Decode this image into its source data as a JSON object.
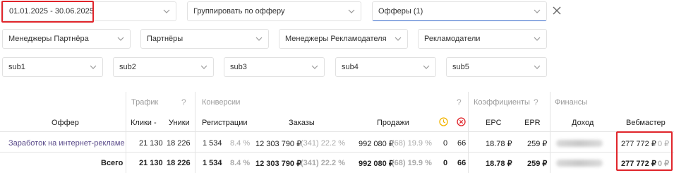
{
  "filters": {
    "date_range": "01.01.2025 - 30.06.2025",
    "group_by": "Группировать по офферу",
    "offers": "Офферы (1)",
    "partner_managers": "Менеджеры Партнёра",
    "partners": "Партнёры",
    "advertiser_managers": "Менеджеры Рекламодателя",
    "advertisers": "Рекламодатели",
    "sub1": "sub1",
    "sub2": "sub2",
    "sub3": "sub3",
    "sub4": "sub4",
    "sub5": "sub5"
  },
  "table": {
    "groups": {
      "traffic": "Трафик",
      "conversions": "Конверсии",
      "coefficients": "Коэффициенты",
      "finance": "Финансы",
      "help": "?"
    },
    "columns": {
      "offer": "Оффер",
      "clicks": "Клики",
      "clicks_sort": "-",
      "uniques": "Уники",
      "registrations": "Регистрации",
      "orders": "Заказы",
      "sales": "Продажи",
      "epc": "EPC",
      "epr": "EPR",
      "income": "Доход",
      "webmaster": "Вебмастер"
    },
    "rows": [
      {
        "offer": "Заработок на интернет-рекламе",
        "clicks": "21 130",
        "uniques": "18 226",
        "registrations": "1 534",
        "reg_pct": "8.4 %",
        "orders": "12 303 790 ₽",
        "orders_extra": "(341) 22.2 %",
        "sales": "992 080 ₽",
        "sales_extra": "(68) 19.9 %",
        "pending": "0",
        "rejected": "66",
        "epc": "18.78 ₽",
        "epr": "259 ₽",
        "webmaster": "277 772 ₽",
        "webmaster_extra": "0 ₽"
      },
      {
        "offer": "Всего",
        "clicks": "21 130",
        "uniques": "18 226",
        "registrations": "1 534",
        "reg_pct": "8.4 %",
        "orders": "12 303 790 ₽",
        "orders_extra": "(341) 22.2 %",
        "sales": "992 080 ₽",
        "sales_extra": "(68) 19.9 %",
        "pending": "0",
        "rejected": "66",
        "epc": "18.78 ₽",
        "epr": "259 ₽",
        "webmaster": "277 772 ₽",
        "webmaster_extra": "0 ₽"
      }
    ]
  },
  "colors": {
    "highlight_red": "#e0252b",
    "pending_icon": "#f2b400",
    "rejected_icon": "#e0252b",
    "link": "#5a4a8a"
  }
}
